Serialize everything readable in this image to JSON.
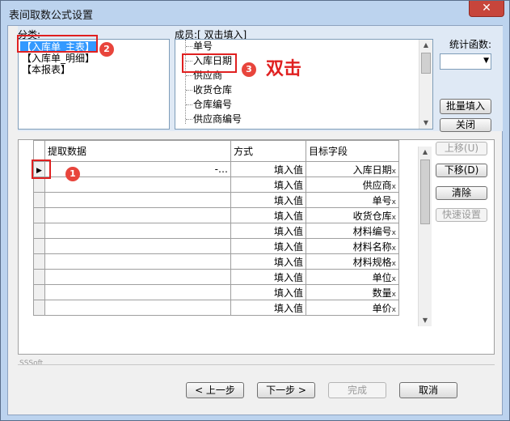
{
  "window": {
    "title": "表间取数公式设置",
    "close_glyph": "✕"
  },
  "category": {
    "label": "分类:",
    "items": [
      "【入库单_主表】",
      "【入库单_明细】",
      "【本报表】"
    ]
  },
  "members": {
    "label": "成员:[ 双击填入]",
    "items": [
      "单号",
      "入库日期",
      "供应商",
      "收货仓库",
      "仓库编号",
      "供应商编号"
    ]
  },
  "stat_func": {
    "label": "统计函数:",
    "value": ""
  },
  "buttons": {
    "batch_fill": "批量填入",
    "close": "关闭",
    "move_up": "上移(U)",
    "move_down": "下移(D)",
    "clear": "清除",
    "quick_setup": "快速设置",
    "prev": "< 上一步",
    "next": "下一步 >",
    "finish": "完成",
    "cancel": "取消"
  },
  "grid": {
    "headers": [
      "提取数据",
      "方式",
      "目标字段"
    ],
    "ellipsis": "-…",
    "delete_mark": "x",
    "rows": [
      {
        "method": "填入值",
        "target": "入库日期"
      },
      {
        "method": "填入值",
        "target": "供应商"
      },
      {
        "method": "填入值",
        "target": "单号"
      },
      {
        "method": "填入值",
        "target": "收货仓库"
      },
      {
        "method": "填入值",
        "target": "材料编号"
      },
      {
        "method": "填入值",
        "target": "材料名称"
      },
      {
        "method": "填入值",
        "target": "材料规格"
      },
      {
        "method": "填入值",
        "target": "单位"
      },
      {
        "method": "填入值",
        "target": "数量"
      },
      {
        "method": "填入值",
        "target": "单价"
      }
    ]
  },
  "brand": "SSSoft",
  "annotations": {
    "badge1": "1",
    "badge2": "2",
    "badge3": "3",
    "note": "双击"
  }
}
